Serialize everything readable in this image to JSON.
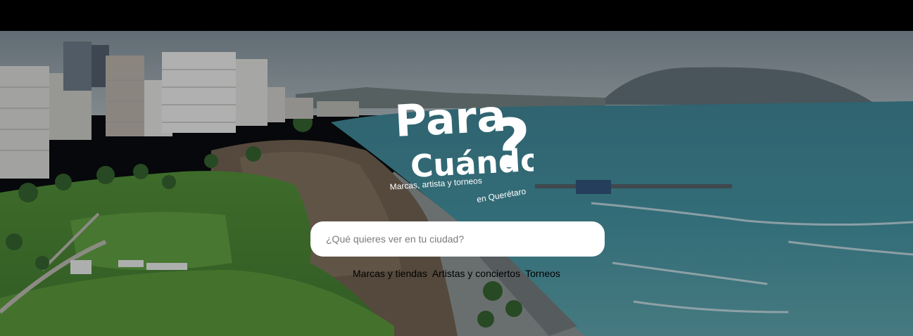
{
  "logo": {
    "line1": "Para",
    "line2": "Cuándo",
    "mark": "?",
    "tagline_a": "Marcas, artista y torneos",
    "tagline_b": "en Querétaro"
  },
  "search": {
    "placeholder": "¿Qué quieres ver en tu ciudad?",
    "value": ""
  },
  "categories": [
    {
      "label": "Marcas y tiendas"
    },
    {
      "label": "Artistas y conciertos"
    },
    {
      "label": "Torneos"
    }
  ],
  "colors": {
    "logo": "#ffffff",
    "sea": "#3d8a96",
    "grass": "#4f8f2e"
  }
}
